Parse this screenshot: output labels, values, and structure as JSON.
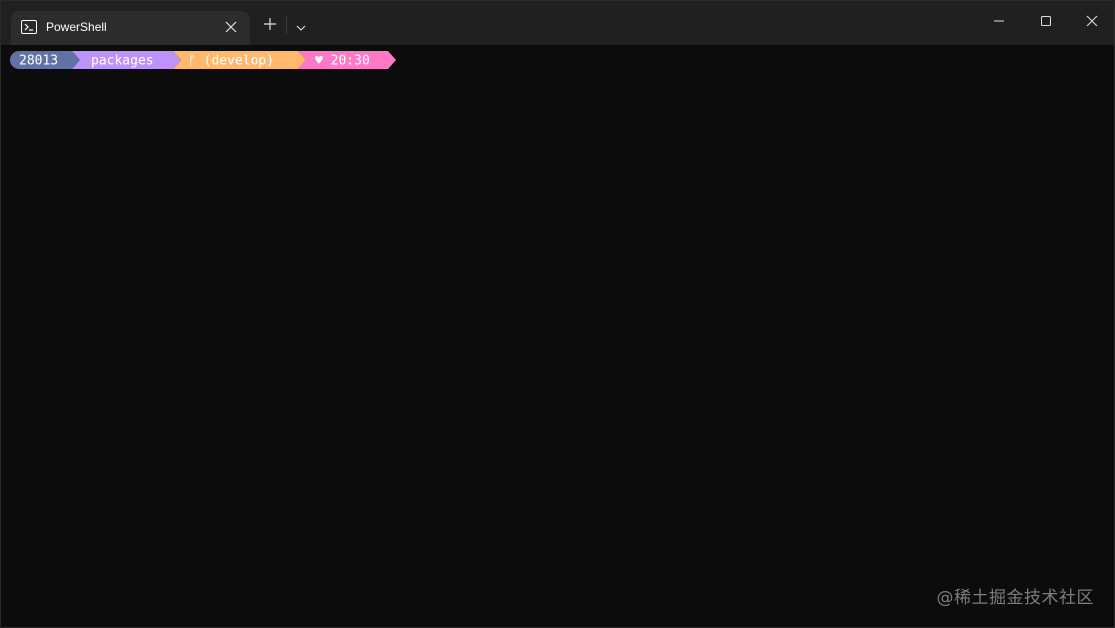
{
  "tab": {
    "title": "PowerShell",
    "icon": "powershell-icon"
  },
  "toolbar": {
    "new_tab_icon": "plus-icon",
    "dropdown_icon": "chevron-down-icon"
  },
  "window_controls": {
    "minimize_icon": "minimize-icon",
    "maximize_icon": "maximize-icon",
    "close_icon": "close-icon"
  },
  "prompt": {
    "segments": [
      {
        "text": "28013",
        "color": "#6272a4"
      },
      {
        "text": "packages",
        "color": "#bd93f9"
      },
      {
        "text": "ᚠ (develop)",
        "color": "#ffb86c",
        "icon": "git-branch-icon"
      },
      {
        "text": "♥ 20:30",
        "color": "#ff79c6",
        "icon": "heart-icon"
      }
    ]
  },
  "terminal": {
    "background": "#0c0c0c"
  },
  "watermark": "@稀土掘金技术社区"
}
